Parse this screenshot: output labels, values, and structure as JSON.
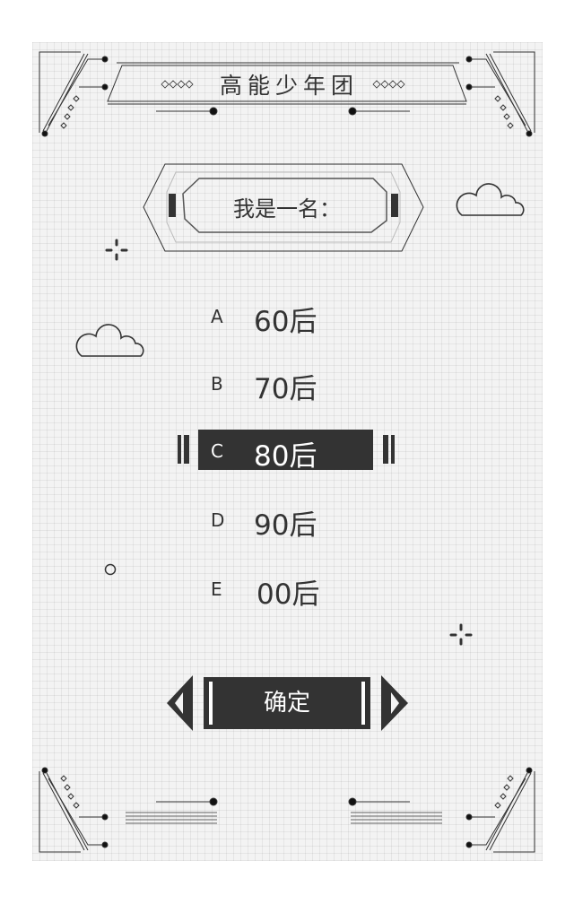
{
  "header": {
    "title": "高能少年团"
  },
  "question": {
    "prompt": "我是一名："
  },
  "options": [
    {
      "letter": "A",
      "label": "60后",
      "selected": false
    },
    {
      "letter": "B",
      "label": "70后",
      "selected": false
    },
    {
      "letter": "C",
      "label": "80后",
      "selected": true
    },
    {
      "letter": "D",
      "label": "90后",
      "selected": false
    },
    {
      "letter": "E",
      "label": "00后",
      "selected": false
    }
  ],
  "actions": {
    "confirm_label": "确定"
  },
  "colors": {
    "dark": "#333333",
    "background": "#f3f3f3"
  }
}
